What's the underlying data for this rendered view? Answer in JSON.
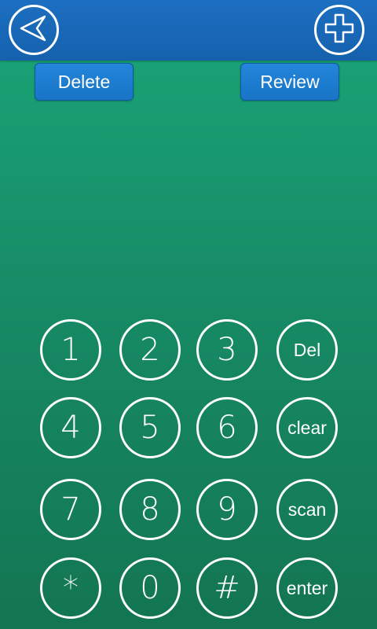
{
  "toolbar": {
    "back_icon": "back-arrow-icon",
    "add_icon": "plus-icon"
  },
  "actions": {
    "delete_label": "Delete",
    "review_label": "Review"
  },
  "keypad": {
    "keys": [
      "1",
      "2",
      "3",
      "Del",
      "4",
      "5",
      "6",
      "clear",
      "7",
      "8",
      "9",
      "scan",
      "*",
      "0",
      "#",
      "enter"
    ]
  },
  "colors": {
    "toolbar": "#1768b8",
    "background_top": "#1aa678",
    "background_bottom": "#137552",
    "button": "#1e7fd2",
    "key_outline": "#ffffff"
  }
}
